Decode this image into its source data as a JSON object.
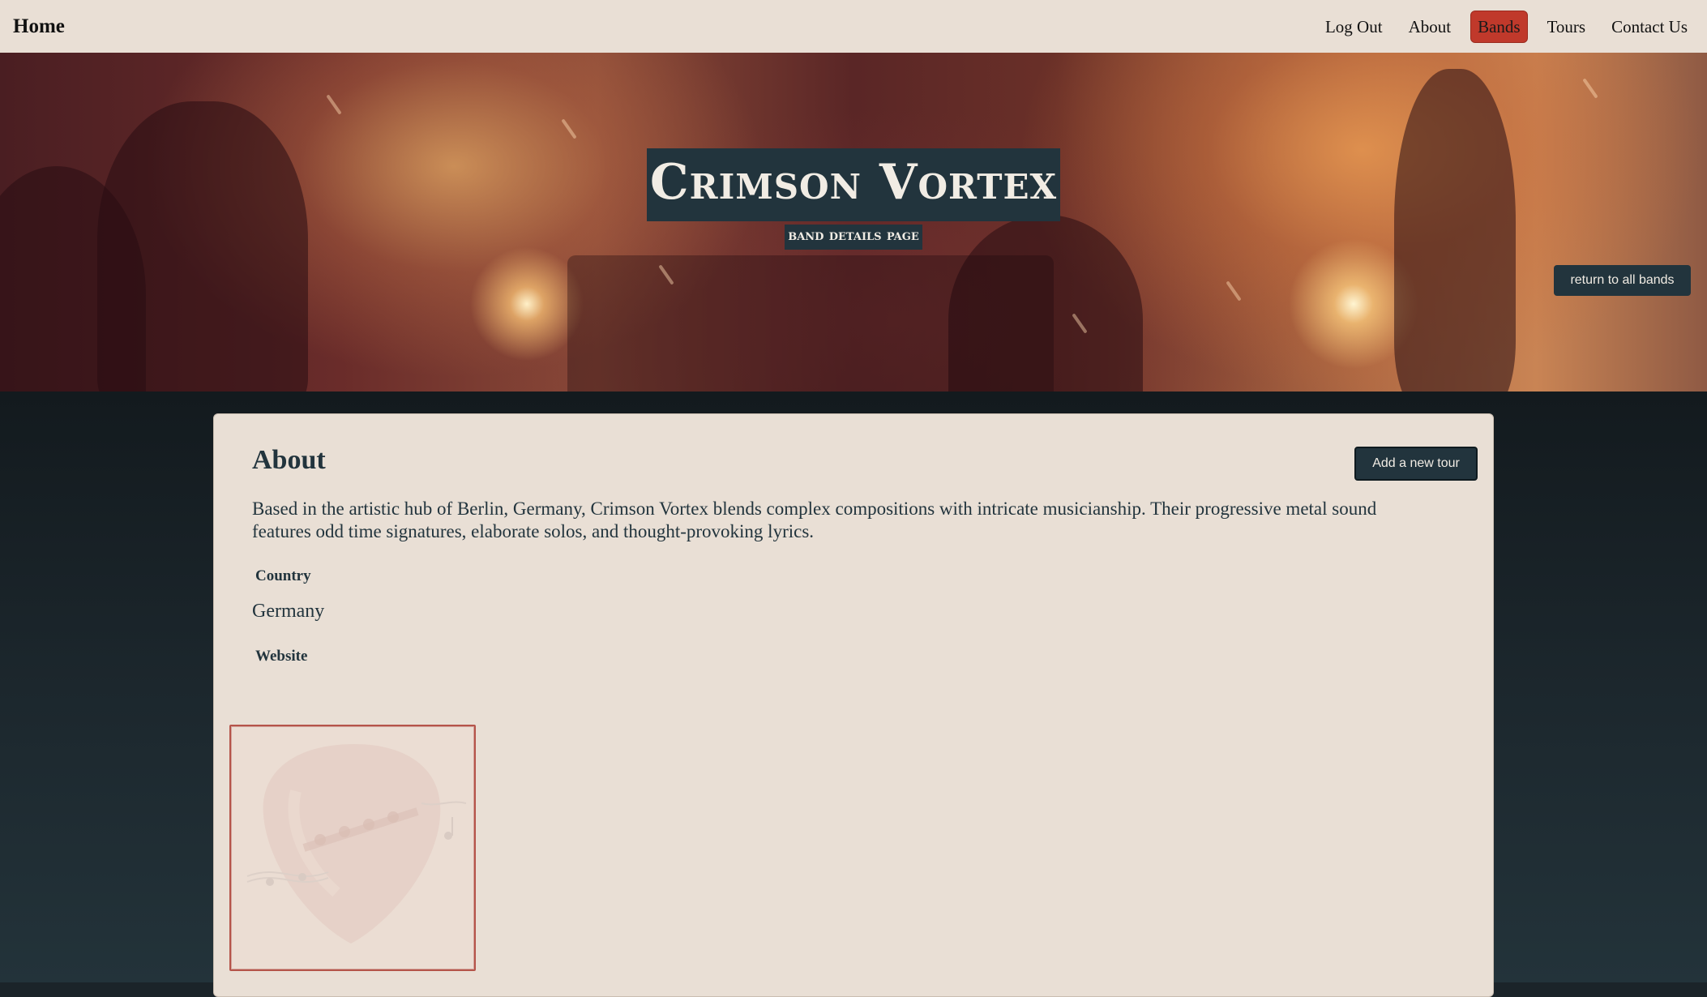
{
  "navbar": {
    "brand": "Home",
    "links": [
      {
        "label": "Log Out",
        "active": false
      },
      {
        "label": "About",
        "active": false
      },
      {
        "label": "Bands",
        "active": true
      },
      {
        "label": "Tours",
        "active": false
      },
      {
        "label": "Contact Us",
        "active": false
      }
    ]
  },
  "hero": {
    "title": "Crimson Vortex",
    "subtitle": "band details page",
    "return_button": "return to all bands"
  },
  "band": {
    "section_heading": "About",
    "add_tour_button": "Add a new tour",
    "description": "Based in the artistic hub of Berlin, Germany, Crimson Vortex blends complex compositions with intricate musicianship. Their progressive metal sound features odd time signatures, elaborate solos, and thought-provoking lyrics.",
    "country_label": "Country",
    "country_value": "Germany",
    "website_label": "Website",
    "website_value": "",
    "image_icon": "guitar-pick-music-placeholder-icon"
  },
  "colors": {
    "navbar_bg": "#e9dfd5",
    "active_nav": "#c0392b",
    "dark_button": "#22343d",
    "card_bg": "#e9dfd5",
    "page_bg": "#1b2429"
  }
}
